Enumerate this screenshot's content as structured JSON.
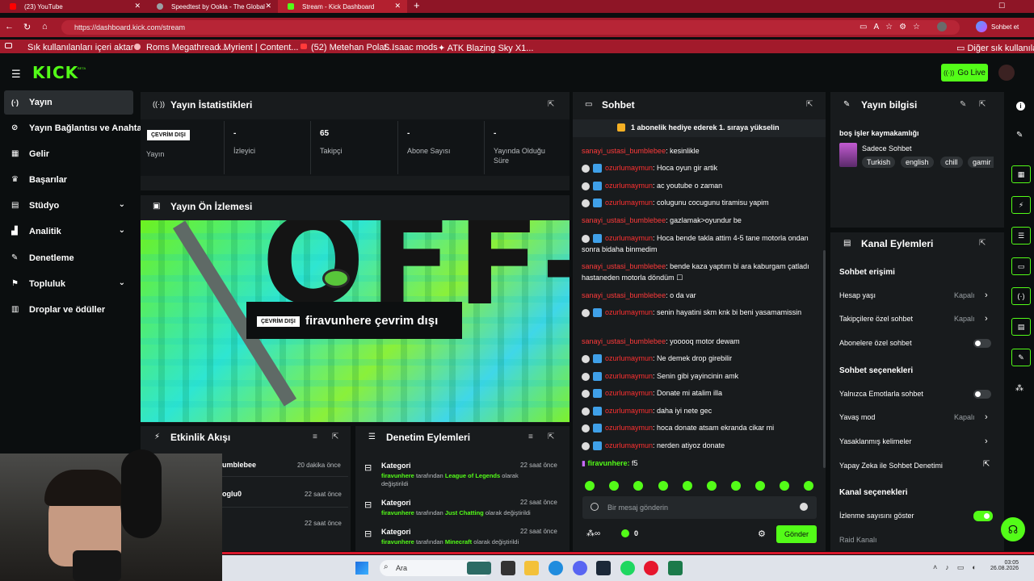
{
  "browser": {
    "tabs": [
      {
        "title": "(23) YouTube",
        "color": "#ff0000"
      },
      {
        "title": "Speedtest by Ookla - The Global B",
        "color": "#9aa0a4"
      },
      {
        "title": "Stream - Kick Dashboard",
        "color": "#53fc18"
      }
    ],
    "url": "https://dashboard.kick.com/stream",
    "sohbet_et": "Sohbet et",
    "bookmarks": [
      "Sık kullanılanları içeri aktar",
      "Roms Megathread...",
      "Myrient | Content...",
      "(52) Metehan Polat...",
      "Isaac mods",
      "ATK Blazing Sky X1..."
    ],
    "other_bookmarks": "Diğer sık kullanılanlar"
  },
  "kick": {
    "logo": "KICK",
    "beta": "BETA",
    "go_live": "Go Live"
  },
  "sidebar": {
    "items": [
      {
        "label": "Yayın",
        "icon": "broadcast-icon",
        "active": true
      },
      {
        "label": "Yayın Bağlantısı ve Anahtar",
        "icon": "link-icon"
      },
      {
        "label": "Gelir",
        "icon": "revenue-icon"
      },
      {
        "label": "Başarılar",
        "icon": "trophy-icon"
      },
      {
        "label": "Stüdyo",
        "icon": "studio-icon",
        "chevron": true
      },
      {
        "label": "Analitik",
        "icon": "analytics-icon",
        "chevron": true
      },
      {
        "label": "Denetleme",
        "icon": "wrench-icon"
      },
      {
        "label": "Topluluk",
        "icon": "community-icon",
        "chevron": true
      },
      {
        "label": "Droplar ve ödüller",
        "icon": "gift-icon"
      }
    ]
  },
  "stats": {
    "title": "Yayın İstatistikleri",
    "offline_badge": "ÇEVRİM DIŞI",
    "items": [
      {
        "value": "",
        "label": "Yayın"
      },
      {
        "value": "-",
        "label": "İzleyici"
      },
      {
        "value": "65",
        "label": "Takipçi"
      },
      {
        "value": "-",
        "label": "Abone Sayısı"
      },
      {
        "value": "-",
        "label": "Yayında Olduğu Süre"
      }
    ]
  },
  "preview": {
    "title": "Yayın Ön İzlemesi",
    "offline_badge": "ÇEVRİM DIŞI",
    "offline_text": "firavunhere çevrim dışı",
    "bg_text": "OFF-LINE"
  },
  "activity": {
    "title": "Etkinlik Akışı",
    "items": [
      {
        "name": "umblebee",
        "time": "20 dakika önce"
      },
      {
        "name": "oglu0",
        "time": "22 saat önce"
      },
      {
        "name": "",
        "time": "22 saat önce"
      }
    ]
  },
  "moderation": {
    "title": "Denetim Eylemleri",
    "items": [
      {
        "title": "Kategori",
        "user": "firavunhere",
        "mid": "tarafından",
        "target": "League of Legends",
        "suffix": "olarak değiştirildi",
        "time": "22 saat önce"
      },
      {
        "title": "Kategori",
        "user": "firavunhere",
        "mid": "tarafından",
        "target": "Just Chatting",
        "suffix": "olarak değiştirildi",
        "time": "22 saat önce"
      },
      {
        "title": "Kategori",
        "user": "firavunhere",
        "mid": "tarafından",
        "target": "Minecraft",
        "suffix": "olarak değiştirildi",
        "time": "22 saat önce"
      }
    ]
  },
  "chat": {
    "title": "Sohbet",
    "pinned": "1 abonelik hediye ederek 1. sıraya yükselin",
    "messages": [
      {
        "user": "sanayi_ustasi_bumblebee",
        "text": ": kesinlikle",
        "badges": false
      },
      {
        "user": "ozurlumaymun",
        "text": ": Hoca oyun gir artik",
        "badges": true
      },
      {
        "user": "ozurlumaymun",
        "text": ": ac youtube o zaman",
        "badges": true
      },
      {
        "user": "ozurlumaymun",
        "text": ": colugunu cocugunu tiramisu yapim",
        "badges": true
      },
      {
        "user": "sanayi_ustasi_bumblebee",
        "text": ": gazlamak>oyundur be",
        "badges": false
      },
      {
        "user": "ozurlumaymun",
        "text": ": Hoca bende takla attim 4-5 tane motorla ondan sonra bidaha binmedim",
        "badges": true
      },
      {
        "user": "sanayi_ustasi_bumblebee",
        "text": ": bende kaza yaptım bi ara kaburgam çatladı hastaneden motorla döndüm ☐",
        "badges": false
      },
      {
        "user": "sanayi_ustasi_bumblebee",
        "text": ": o da var",
        "badges": false
      },
      {
        "user": "ozurlumaymun",
        "text": ": senin hayatini skm knk bi beni yasamamissin",
        "badges": true
      },
      {
        "user": "sanayi_ustasi_bumblebee",
        "text": ": yooooq motor dewam",
        "badges": false
      },
      {
        "user": "ozurlumaymun",
        "text": ": Ne demek drop girebilir",
        "badges": true
      },
      {
        "user": "ozurlumaymun",
        "text": ": Senin gibi yayincinin amk",
        "badges": true
      },
      {
        "user": "ozurlumaymun",
        "text": ": Donate mi atalim illa",
        "badges": true
      },
      {
        "user": "ozurlumaymun",
        "text": ": daha iyi nete gec",
        "badges": true
      },
      {
        "user": "ozurlumaymun",
        "text": ": hoca donate atsam ekranda cikar mi",
        "badges": true
      },
      {
        "user": "ozurlumaymun",
        "text": ": nerden atiyoz donate",
        "badges": true
      }
    ],
    "own": {
      "user": "firavunhere:",
      "text": "f5"
    },
    "placeholder": "Bir mesaj gönderin",
    "count": "0",
    "send": "Gönder"
  },
  "info": {
    "title": "Yayın bilgisi",
    "stream_title": "boş işler kaymakamlığı",
    "category": "Sadece Sohbet",
    "tags": [
      "Turkish",
      "english",
      "chill",
      "gamir"
    ]
  },
  "channel_actions": {
    "title": "Kanal Eylemleri",
    "chat_access": "Sohbet erişimi",
    "rows1": [
      {
        "label": "Hesap yaşı",
        "value": "Kapalı"
      },
      {
        "label": "Takipçilere özel sohbet",
        "value": "Kapalı"
      },
      {
        "label": "Abonelere özel sohbet",
        "value": ""
      }
    ],
    "chat_options": "Sohbet seçenekleri",
    "rows2": [
      {
        "label": "Yalnızca Emotlarla sohbet",
        "value": ""
      },
      {
        "label": "Yavaş mod",
        "value": "Kapalı"
      },
      {
        "label": "Yasaklanmış kelimeler",
        "value": ""
      },
      {
        "label": "Yapay Zeka ile Sohbet Denetimi",
        "value": ""
      }
    ],
    "channel_options": "Kanal seçenekleri",
    "show_views": "İzlenme sayısını göster",
    "raid": "Raid Kanalı"
  },
  "taskbar": {
    "search": "Ara",
    "time": "03:05",
    "date": "26.08.2026"
  },
  "colors": {
    "accent": "#53fc18",
    "user_red": "#ff3a3a",
    "browser": "#a21a2b"
  }
}
